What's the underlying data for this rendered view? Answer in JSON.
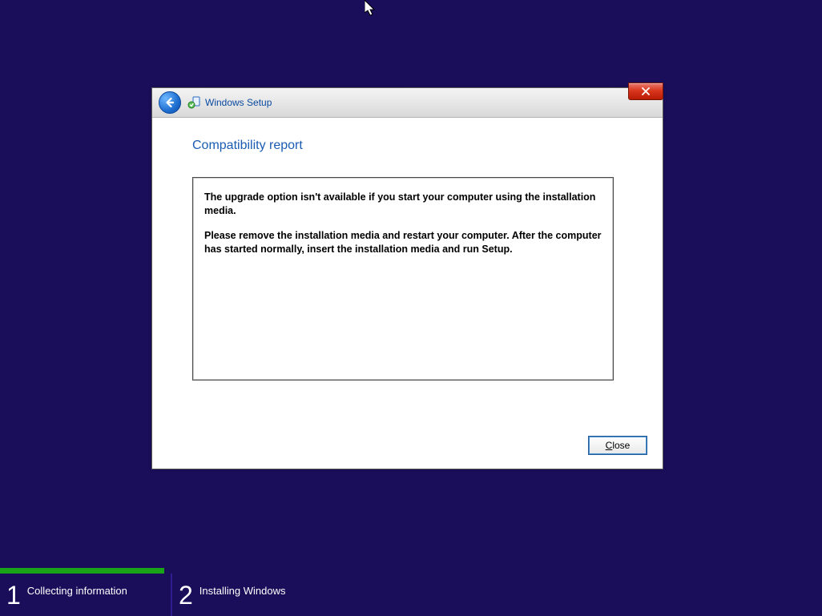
{
  "window": {
    "title": "Windows Setup",
    "heading": "Compatibility report",
    "message_line1": "The upgrade option isn't available if you start your computer using the installation media.",
    "message_line2": "Please remove the installation media and restart your computer. After the computer has started normally, insert the installation media and run Setup.",
    "close_button_prefix": "",
    "close_button_accel": "C",
    "close_button_suffix": "lose"
  },
  "steps": {
    "step1_num": "1",
    "step1_label": "Collecting information",
    "step2_num": "2",
    "step2_label": "Installing Windows"
  }
}
